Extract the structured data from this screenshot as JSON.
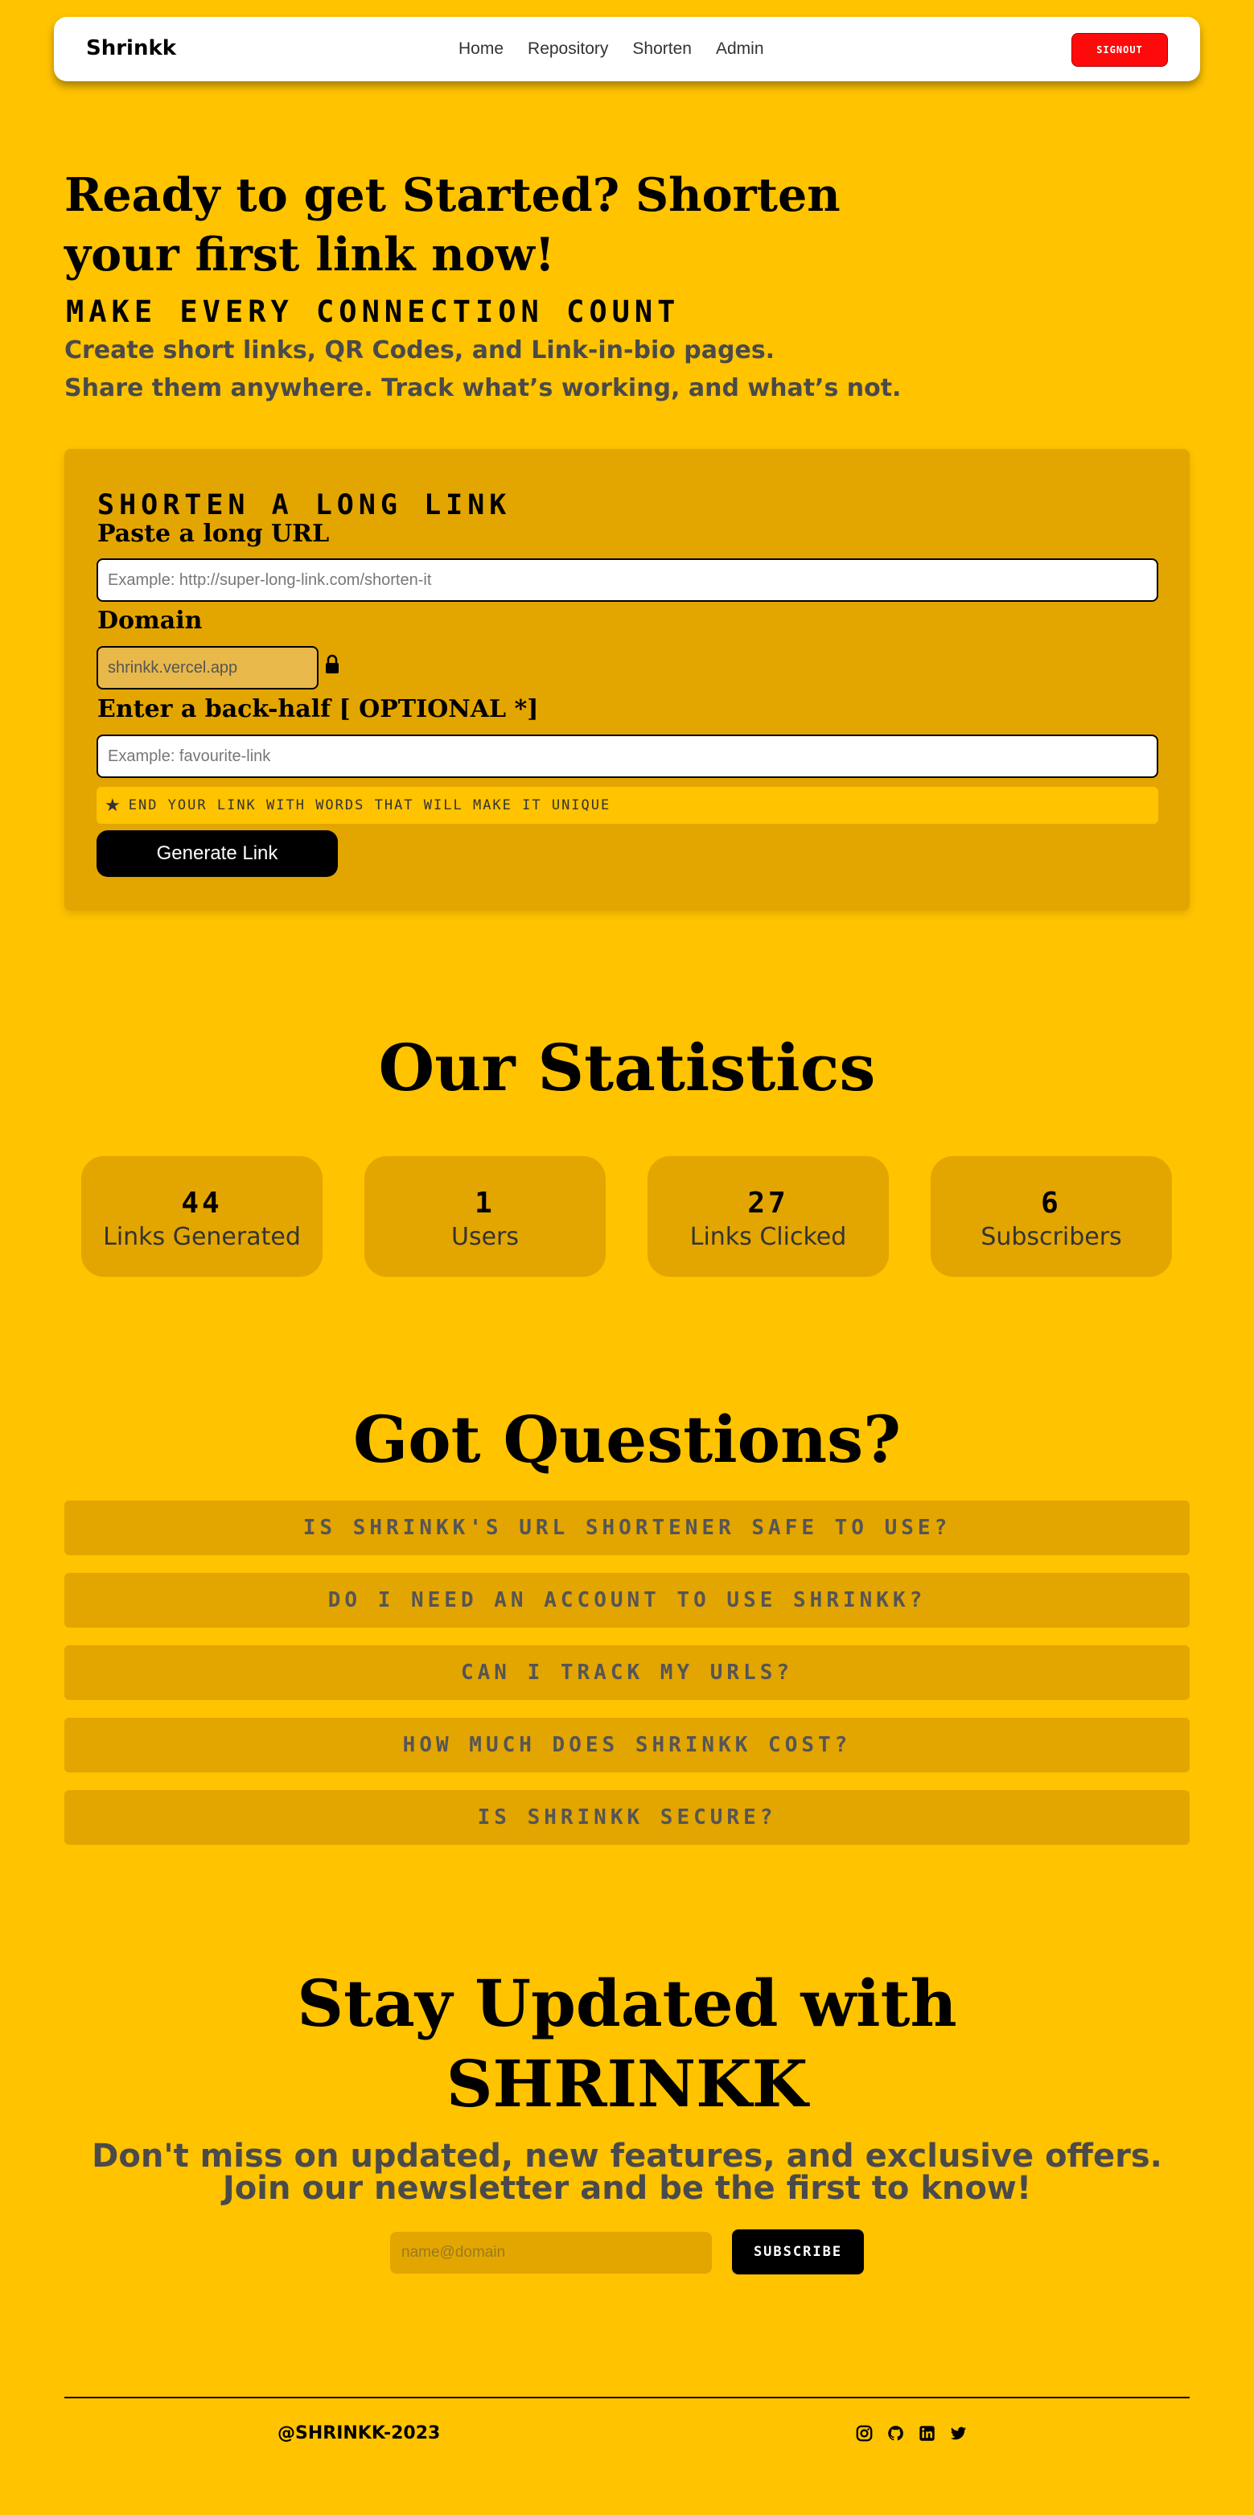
{
  "nav": {
    "brand": "Shrinkk",
    "links": [
      "Home",
      "Repository",
      "Shorten",
      "Admin"
    ],
    "signout_label": "SIGNOUT"
  },
  "hero": {
    "title_line1": "Ready to get Started? Shorten",
    "title_line2": "your first link now!",
    "tagline": "Make every connection count",
    "sub_line1": "Create short links, QR Codes, and Link-in-bio pages.",
    "sub_line2": "Share them anywhere. Track what’s working, and what’s not."
  },
  "shorten": {
    "heading": "SHORTEN A LONG LINK",
    "url_label": "Paste a long URL",
    "url_placeholder": "Example: http://super-long-link.com/shorten-it",
    "domain_label": "Domain",
    "domain_value": "shrinkk.vercel.app",
    "backhalf_label": "Enter a back-half  [ OPTIONAL *]",
    "backhalf_placeholder": "Example: favourite-link",
    "hint": "End your link with words that will make it unique",
    "generate_label": "Generate Link"
  },
  "stats": {
    "title": "Our Statistics",
    "items": [
      {
        "value": "44",
        "label": "Links Generated"
      },
      {
        "value": "1",
        "label": "Users"
      },
      {
        "value": "27",
        "label": "Links Clicked"
      },
      {
        "value": "6",
        "label": "Subscribers"
      }
    ]
  },
  "faq": {
    "title": "Got Questions?",
    "questions": [
      "Is Shrinkk's URL shortener safe to use?",
      "Do I need an account to use Shrinkk?",
      "Can I track my URLs?",
      "How much does Shrinkk cost?",
      "Is Shrinkk secure?"
    ]
  },
  "newsletter": {
    "title_line1": "Stay Updated with",
    "title_line2": "SHRINKK",
    "sub_line1": "Don't miss on updated, new features, and exclusive offers.",
    "sub_line2": "Join our newsletter and be the first to know!",
    "email_placeholder": "name@domain",
    "subscribe_label": "SUBSCRIBE"
  },
  "footer": {
    "copyright": "@SHRINKK-2023",
    "socials": [
      "instagram-icon",
      "github-icon",
      "linkedin-icon",
      "twitter-icon"
    ]
  },
  "colors": {
    "background": "#FFC300",
    "card": "#E3A500",
    "signout": "#FF0A0A",
    "button": "#000000"
  }
}
